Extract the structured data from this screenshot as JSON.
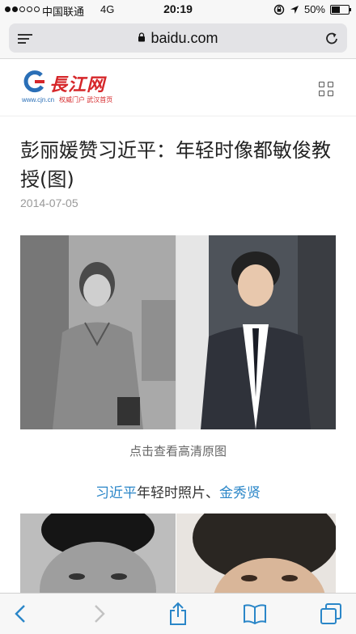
{
  "status_bar": {
    "signal_bars": 5,
    "signal_filled": 2,
    "carrier": "中国联通",
    "network": "4G",
    "time": "20:19",
    "battery_percent": "50%",
    "battery_level": 0.5,
    "icons": [
      "orientation-lock-icon",
      "location-arrow-icon",
      "battery-icon"
    ]
  },
  "browser": {
    "url": "baidu.com",
    "icons": [
      "reader-mode-icon",
      "lock-icon",
      "reload-icon"
    ]
  },
  "site": {
    "logo_text": "長江网",
    "logo_url": "www.cjn.cn",
    "logo_tagline": "权威门户 武汉首页",
    "menu_icon": "grid-menu-icon"
  },
  "article": {
    "title": "彭丽媛赞习近平：年轻时像都敏俊教授(图)",
    "date": "2014-07-05",
    "image_caption": "点击查看高清原图",
    "related": {
      "link1": "习近平",
      "middle": "年轻时照片、",
      "link2": "金秀贤"
    }
  },
  "toolbar": {
    "icons": [
      "back-icon",
      "forward-icon",
      "share-icon",
      "bookmarks-icon",
      "tabs-icon"
    ]
  },
  "colors": {
    "link": "#2a86c8",
    "logo_red": "#d6272a",
    "logo_blue": "#2a6fb7"
  }
}
